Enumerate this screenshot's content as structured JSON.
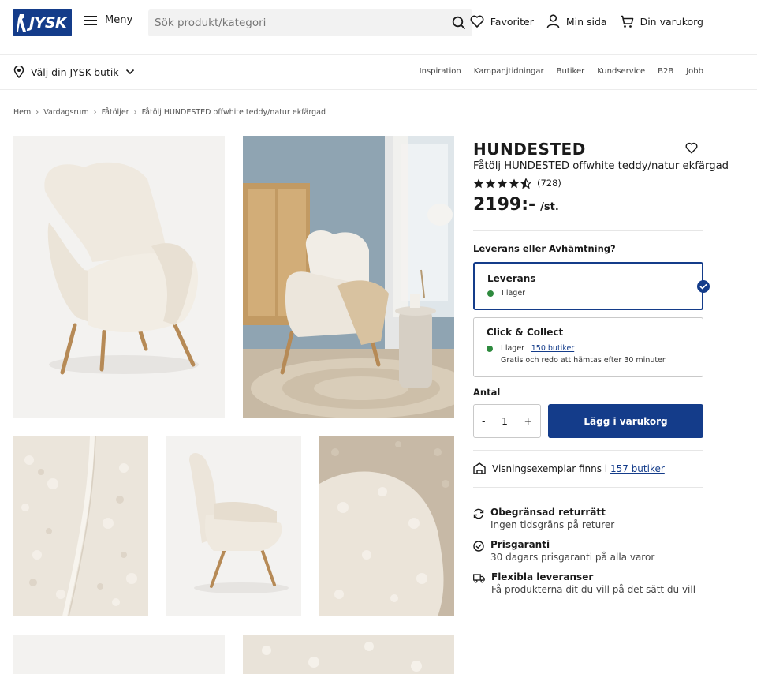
{
  "header": {
    "logo_text": "JYSK",
    "menu_label": "Meny",
    "search_placeholder": "Sök produkt/kategori",
    "favorites": "Favoriter",
    "my_page": "Min sida",
    "cart": "Din varukorg"
  },
  "subbar": {
    "store_select": "Välj din JYSK-butik",
    "links": [
      "Inspiration",
      "Kampanjtidningar",
      "Butiker",
      "Kundservice",
      "B2B",
      "Jobb"
    ]
  },
  "breadcrumb": [
    "Hem",
    "Vardagsrum",
    "Fåtöljer",
    "Fåtölj HUNDESTED offwhite teddy/natur ekfärgad"
  ],
  "product": {
    "name": "HUNDESTED",
    "subtitle": "Fåtölj HUNDESTED offwhite teddy/natur ekfärgad",
    "rating_value": 4.5,
    "rating_count": "(728)",
    "price": "2199:-",
    "price_unit": "/st."
  },
  "delivery": {
    "question": "Leverans eller Avhämtning?",
    "options": [
      {
        "title": "Leverans",
        "status": "I lager",
        "selected": true
      },
      {
        "title": "Click & Collect",
        "status_prefix": "I lager i ",
        "status_link": "150 butiker",
        "note": "Gratis och redo att hämtas efter 30 minuter",
        "selected": false
      }
    ]
  },
  "cart": {
    "qty_label": "Antal",
    "minus": "-",
    "qty": "1",
    "plus": "+",
    "add_button": "Lägg i varukorg"
  },
  "showroom": {
    "prefix": "Visningsexemplar finns i ",
    "link": "157 butiker"
  },
  "usps": [
    {
      "icon": "return-icon",
      "title": "Obegränsad returrätt",
      "text": "Ingen tidsgräns på returer"
    },
    {
      "icon": "check-circle-icon",
      "title": "Prisgaranti",
      "text": "30 dagars prisgaranti på alla varor"
    },
    {
      "icon": "truck-icon",
      "title": "Flexibla leveranser",
      "text": "Få produkterna dit du vill på det sätt du vill"
    }
  ],
  "colors": {
    "brand": "#143c8a",
    "stock_green": "#2e8a3e"
  }
}
